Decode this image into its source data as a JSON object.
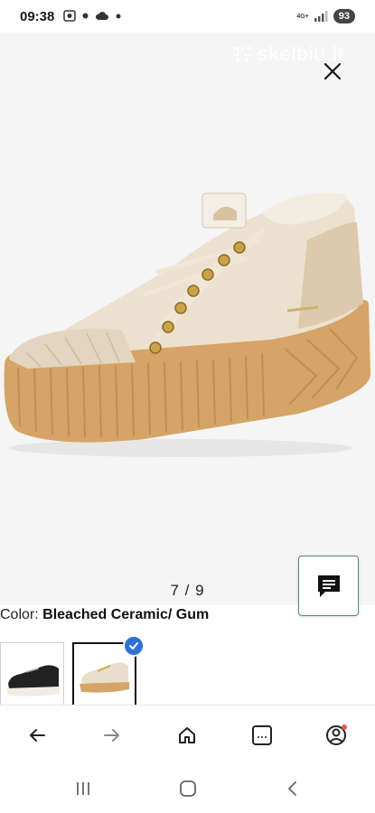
{
  "status_bar": {
    "time": "09:38",
    "network": "4G+",
    "battery": "93",
    "left_icons": [
      "screen-record-icon",
      "dot-icon",
      "cloud-icon",
      "dot-icon"
    ]
  },
  "viewer": {
    "watermark": "skelbiu.lt",
    "image_counter": "7 / 9",
    "background": "#f5f5f5"
  },
  "product": {
    "color_label": "Color:",
    "color_value": "Bleached Ceramic/ Gum",
    "shoe_color": "#ece1cf",
    "sole_color": "#d5a466"
  },
  "thumbnails": [
    {
      "name": "black-sneaker",
      "selected": false
    },
    {
      "name": "bleached-ceramic-sneaker",
      "selected": true
    }
  ],
  "browser_nav": [
    "back-arrow-icon",
    "forward-arrow-icon",
    "home-icon",
    "tabs-icon",
    "account-icon"
  ],
  "system_nav": [
    "recent-apps-icon",
    "home-circle-icon",
    "back-chevron-icon"
  ],
  "accent_color": "#2f6fdc",
  "chat_border_color": "#4a8a93"
}
